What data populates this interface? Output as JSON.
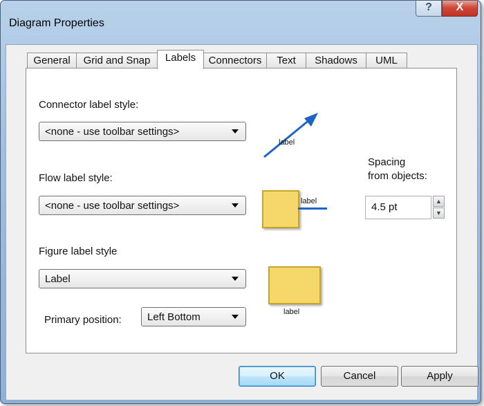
{
  "window": {
    "title": "Diagram Properties"
  },
  "caption_buttons": {
    "help_glyph": "?",
    "close_glyph": "X"
  },
  "tabs": [
    {
      "label": "General",
      "active": false
    },
    {
      "label": "Grid and Snap",
      "active": false
    },
    {
      "label": "Labels",
      "active": true
    },
    {
      "label": "Connectors",
      "active": false
    },
    {
      "label": "Text",
      "active": false
    },
    {
      "label": "Shadows",
      "active": false
    },
    {
      "label": "UML",
      "active": false
    }
  ],
  "connector": {
    "label": "Connector label style:",
    "value": "<none - use toolbar settings>",
    "preview_text": "label"
  },
  "flow": {
    "label": "Flow label style:",
    "value": "<none - use toolbar settings>",
    "preview_text": "label"
  },
  "figure": {
    "label": "Figure label style",
    "value": "Label",
    "preview_text": "label"
  },
  "primary_position": {
    "label": "Primary position:",
    "value": "Left Bottom"
  },
  "spacing": {
    "label_line1": "Spacing",
    "label_line2": "from objects:",
    "value": "4.5 pt"
  },
  "buttons": {
    "ok": "OK",
    "cancel": "Cancel",
    "apply": "Apply"
  },
  "colors": {
    "accent_arrow": "#1f63c6",
    "preview_fill": "#f6d86a",
    "preview_border": "#c7a42c",
    "close_red": "#c8402f"
  }
}
